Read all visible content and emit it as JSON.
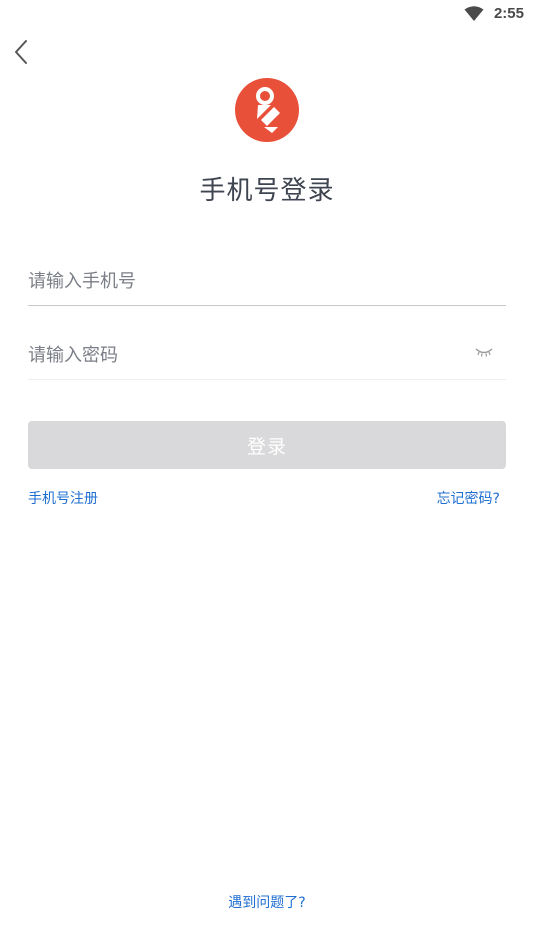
{
  "status_bar": {
    "time": "2:55",
    "wifi_icon": "wifi-icon"
  },
  "header": {
    "back_icon": "chevron-left-icon"
  },
  "logo": {
    "icon": "app-logo",
    "color": "#e8503a"
  },
  "title": "手机号登录",
  "form": {
    "phone_placeholder": "请输入手机号",
    "phone_value": "",
    "password_placeholder": "请输入密码",
    "password_value": "",
    "password_toggle_icon": "eye-closed-icon",
    "login_label": "登录"
  },
  "links": {
    "register": "手机号注册",
    "forgot_password": "忘记密码?",
    "help": "遇到问题了?"
  },
  "colors": {
    "link": "#1f6fd1",
    "button_disabled": "#d9d9db"
  }
}
